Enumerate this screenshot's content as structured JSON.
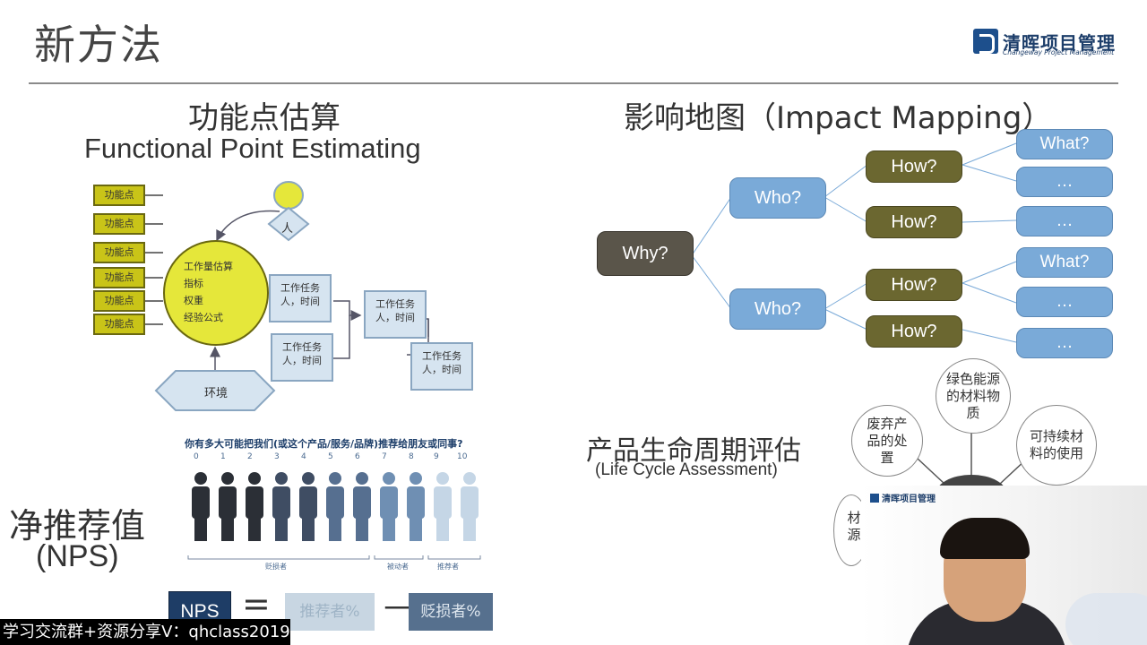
{
  "header": {
    "title": "新方法",
    "logo_name": "清晖项目管理",
    "logo_sub": "Changeway Project Management"
  },
  "function_point": {
    "title_cn": "功能点估算",
    "title_en": "Functional Point Estimating",
    "fp_boxes": [
      "功能点",
      "功能点",
      "功能点",
      "功能点",
      "功能点",
      "功能点"
    ],
    "circle_lines": [
      "工作量估算",
      "指标",
      "权重",
      "经验公式"
    ],
    "person_label": "人",
    "environment_label": "环境",
    "tasks": [
      {
        "line1": "工作任务",
        "line2": "人，时间"
      },
      {
        "line1": "工作任务",
        "line2": "人，时间"
      },
      {
        "line1": "工作任务",
        "line2": "人，时间"
      },
      {
        "line1": "工作任务",
        "line2": "人，时间"
      }
    ]
  },
  "impact_mapping": {
    "title": "影响地图（Impact Mapping）",
    "why": "Why?",
    "who": [
      "Who?",
      "Who?"
    ],
    "how": [
      "How?",
      "How?",
      "How?",
      "How?"
    ],
    "what": [
      "What?",
      "…",
      "…",
      "What?",
      "…",
      "…"
    ]
  },
  "lca": {
    "title_cn": "产品生命周期评估",
    "title_en": "(Life Cycle Assessment)",
    "circles": [
      "绿色能源的材料物质",
      "废弃产品的处置",
      "可持续材料的使用",
      "材源"
    ]
  },
  "nps": {
    "title_cn": "净推荐值",
    "title_en": "(NPS)",
    "question": "你有多大可能把我们(或这个产品/服务/品牌)推荐给朋友或同事?",
    "scale": [
      "0",
      "1",
      "2",
      "3",
      "4",
      "5",
      "6",
      "7",
      "8",
      "9",
      "10"
    ],
    "groups": [
      "贬损者",
      "被动者",
      "推荐者"
    ],
    "formula_label": "NPS",
    "equals": "=",
    "promoters": "推荐者%",
    "minus": "—",
    "detractors": "贬损者%",
    "colors": {
      "dark": "#2b2f36",
      "mid": "#6f8fb3",
      "light": "#c5d6e6"
    }
  },
  "overlay": {
    "watermark": "学习交流群+资源分享V：qhclass2019",
    "video_logo": "清晖项目管理"
  }
}
